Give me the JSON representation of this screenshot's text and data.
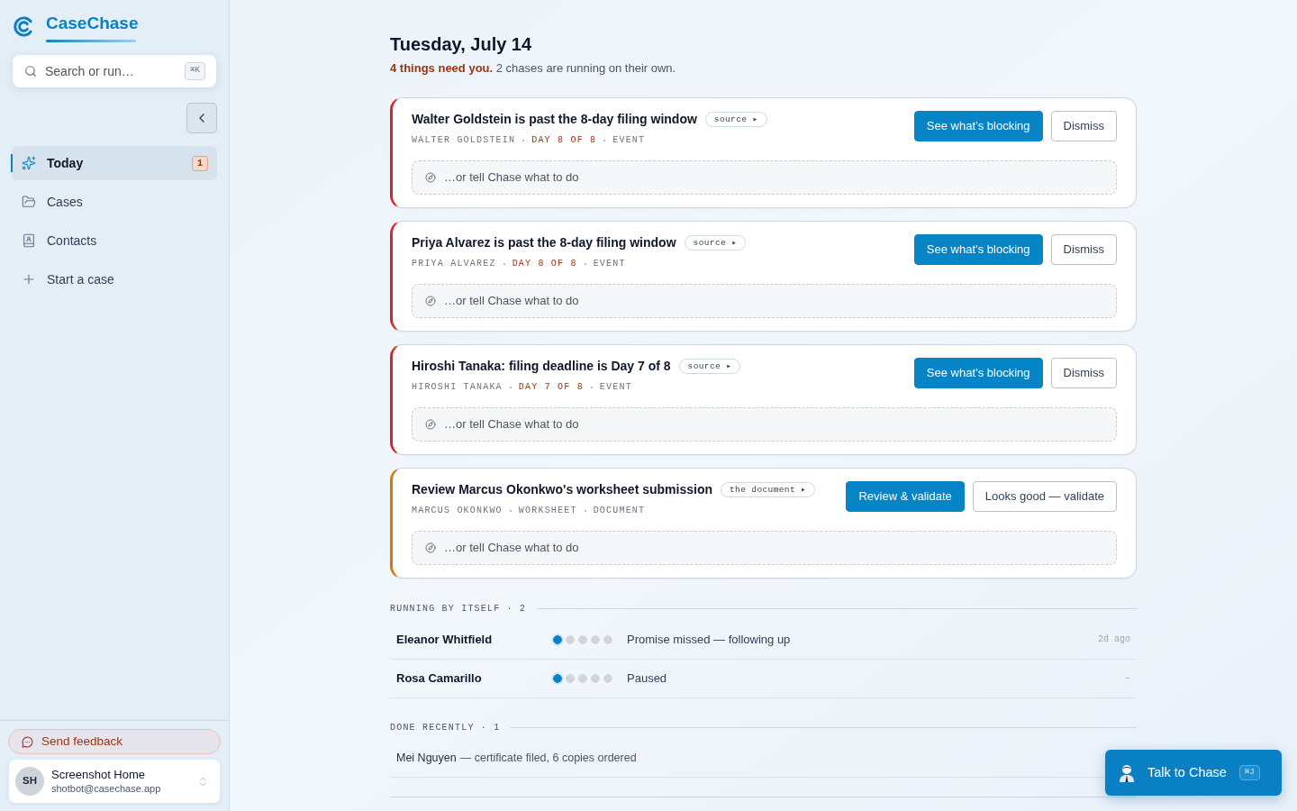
{
  "sidebar": {
    "brand": "CaseChase",
    "search": {
      "placeholder": "Search or run…",
      "shortcut": "⌘K"
    },
    "nav": [
      {
        "kind": "today",
        "label": "Today",
        "selected": true,
        "badge": "1"
      },
      {
        "kind": "cases",
        "label": "Cases",
        "selected": false
      },
      {
        "kind": "contacts",
        "label": "Contacts",
        "selected": false
      },
      {
        "kind": "new",
        "label": "Start a case",
        "selected": false
      }
    ],
    "feedback_button": "Send feedback",
    "user": {
      "initials": "SH",
      "name": "Screenshot Home",
      "email": "shotbot@casechase.app"
    }
  },
  "header": {
    "title": "Tuesday, July 14",
    "summary": "**4 things need you.** 2 chases are running on their own."
  },
  "tasks": [
    {
      "kind": "urgent",
      "title": "Walter Goldstein is past the 8-day filing window",
      "chip": "source ▸",
      "meta": [
        {
          "kind": "plain",
          "text": "WALTER GOLDSTEIN"
        },
        {
          "kind": "deadline",
          "text": "DAY 8 OF 8"
        },
        {
          "kind": "plain",
          "text": "EVENT"
        }
      ],
      "prompt": {
        "placeholder": "…or tell Chase what to do"
      },
      "actions": [
        {
          "kind": "primary",
          "label": "See what’s blocking"
        },
        {
          "kind": "secondary",
          "label": "Dismiss"
        }
      ]
    },
    {
      "kind": "urgent",
      "title": "Priya Alvarez is past the 8-day filing window",
      "chip": "source ▸",
      "meta": [
        {
          "kind": "plain",
          "text": "PRIYA ALVAREZ"
        },
        {
          "kind": "deadline",
          "text": "DAY 8 OF 8"
        },
        {
          "kind": "plain",
          "text": "EVENT"
        }
      ],
      "prompt": {
        "placeholder": "…or tell Chase what to do"
      },
      "actions": [
        {
          "kind": "primary",
          "label": "See what’s blocking"
        },
        {
          "kind": "secondary",
          "label": "Dismiss"
        }
      ]
    },
    {
      "kind": "urgent",
      "title": "Hiroshi Tanaka: filing deadline is Day 7 of 8",
      "chip": "source ▸",
      "meta": [
        {
          "kind": "plain",
          "text": "HIROSHI TANAKA"
        },
        {
          "kind": "deadline",
          "text": "DAY 7 OF 8"
        },
        {
          "kind": "plain",
          "text": "EVENT"
        }
      ],
      "prompt": {
        "placeholder": "…or tell Chase what to do"
      },
      "actions": [
        {
          "kind": "primary",
          "label": "See what’s blocking"
        },
        {
          "kind": "secondary",
          "label": "Dismiss"
        }
      ]
    },
    {
      "kind": "review",
      "title": "Review Marcus Okonkwo's worksheet submission",
      "chip": "the document ▸",
      "meta": [
        {
          "kind": "plain",
          "text": "MARCUS OKONKWO"
        },
        {
          "kind": "plain",
          "text": "WORKSHEET"
        },
        {
          "kind": "plain",
          "text": "DOCUMENT"
        }
      ],
      "prompt": {
        "placeholder": "…or tell Chase what to do"
      },
      "actions": [
        {
          "kind": "primary",
          "label": "Review & validate"
        },
        {
          "kind": "secondary",
          "label": "Looks good — validate"
        }
      ]
    }
  ],
  "running": {
    "heading": "RUNNING BY ITSELF · 2",
    "rows": [
      {
        "name": "Eleanor Whitfield",
        "level": 0.2,
        "status": "Promise missed — following up",
        "time": "2d ago"
      },
      {
        "name": "Rosa Camarillo",
        "level": 0.2,
        "status": "Paused",
        "time": "–"
      }
    ]
  },
  "done": {
    "heading": "DONE RECENTLY · 1",
    "rows": [
      {
        "name": "Mei Nguyen",
        "detail": "— certificate filed, 6 copies ordered"
      }
    ]
  },
  "chat_button": {
    "label": "Talk to Chase",
    "shortcut": "⌘J"
  }
}
